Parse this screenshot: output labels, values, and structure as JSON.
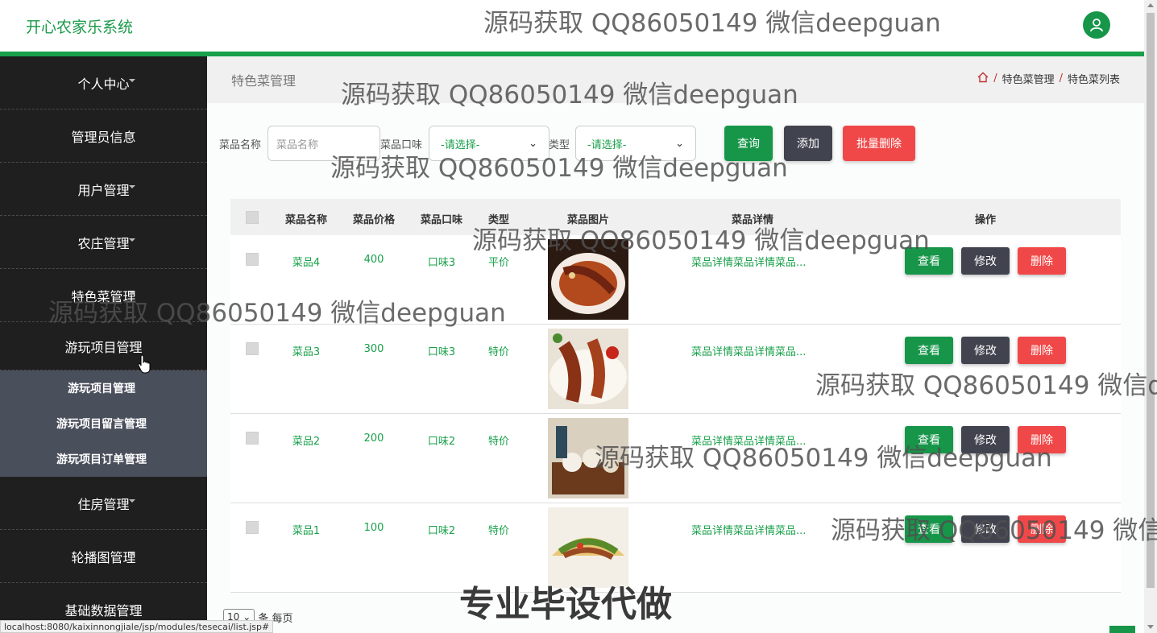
{
  "app": {
    "title": "开心农家乐系统"
  },
  "colors": {
    "accent": "#18a04a",
    "sidebar": "#1f1f1f",
    "submenu": "#4a4f5c",
    "danger": "#f04848",
    "dark": "#41434f"
  },
  "header": {
    "avatar_icon": "user-icon"
  },
  "sidebar": {
    "items": [
      {
        "label": "个人中心"
      },
      {
        "label": "管理员信息"
      },
      {
        "label": "用户管理"
      },
      {
        "label": "农庄管理"
      },
      {
        "label": "特色菜管理"
      },
      {
        "label": "游玩项目管理"
      },
      {
        "label": "住房管理"
      },
      {
        "label": "轮播图管理"
      },
      {
        "label": "基础数据管理"
      }
    ],
    "submenu": [
      {
        "label": "游玩项目管理"
      },
      {
        "label": "游玩项目留言管理"
      },
      {
        "label": "游玩项目订单管理"
      }
    ]
  },
  "page": {
    "heading": "特色菜管理",
    "breadcrumb": [
      "特色菜管理",
      "特色菜列表"
    ],
    "breadcrumb_sep": "/"
  },
  "search": {
    "name_label": "菜品名称",
    "name_placeholder": "菜品名称",
    "taste_label": "菜品口味",
    "taste_value": "-请选择-",
    "type_label": "类型",
    "type_value": "-请选择-",
    "query": "查询",
    "add": "添加",
    "batch_delete": "批量删除"
  },
  "table": {
    "headers": [
      "菜品名称",
      "菜品价格",
      "菜品口味",
      "类型",
      "菜品图片",
      "菜品详情",
      "操作"
    ],
    "actions": {
      "view": "查看",
      "edit": "修改",
      "delete": "删除"
    },
    "rows": [
      {
        "name": "菜品4",
        "price": "400",
        "taste": "口味3",
        "type": "平价",
        "detail": "菜品详情菜品详情菜品..."
      },
      {
        "name": "菜品3",
        "price": "300",
        "taste": "口味3",
        "type": "特价",
        "detail": "菜品详情菜品详情菜品..."
      },
      {
        "name": "菜品2",
        "price": "200",
        "taste": "口味2",
        "type": "特价",
        "detail": "菜品详情菜品详情菜品..."
      },
      {
        "name": "菜品1",
        "price": "100",
        "taste": "口味2",
        "type": "特价",
        "detail": "菜品详情菜品详情菜品..."
      }
    ]
  },
  "pager": {
    "page_size": "10",
    "per_page_label": "条 每页"
  },
  "status_url": "localhost:8080/kaixinnongjiale/jsp/modules/tesecai/list.jsp#",
  "watermarks": {
    "text": "源码获取 QQ86050149 微信deepguan",
    "text_cut1": "源码获取 QQ86050149 微信de",
    "text_cut2": "源码获取 QQ86050149 微信d",
    "promo": "专业毕设代做"
  }
}
